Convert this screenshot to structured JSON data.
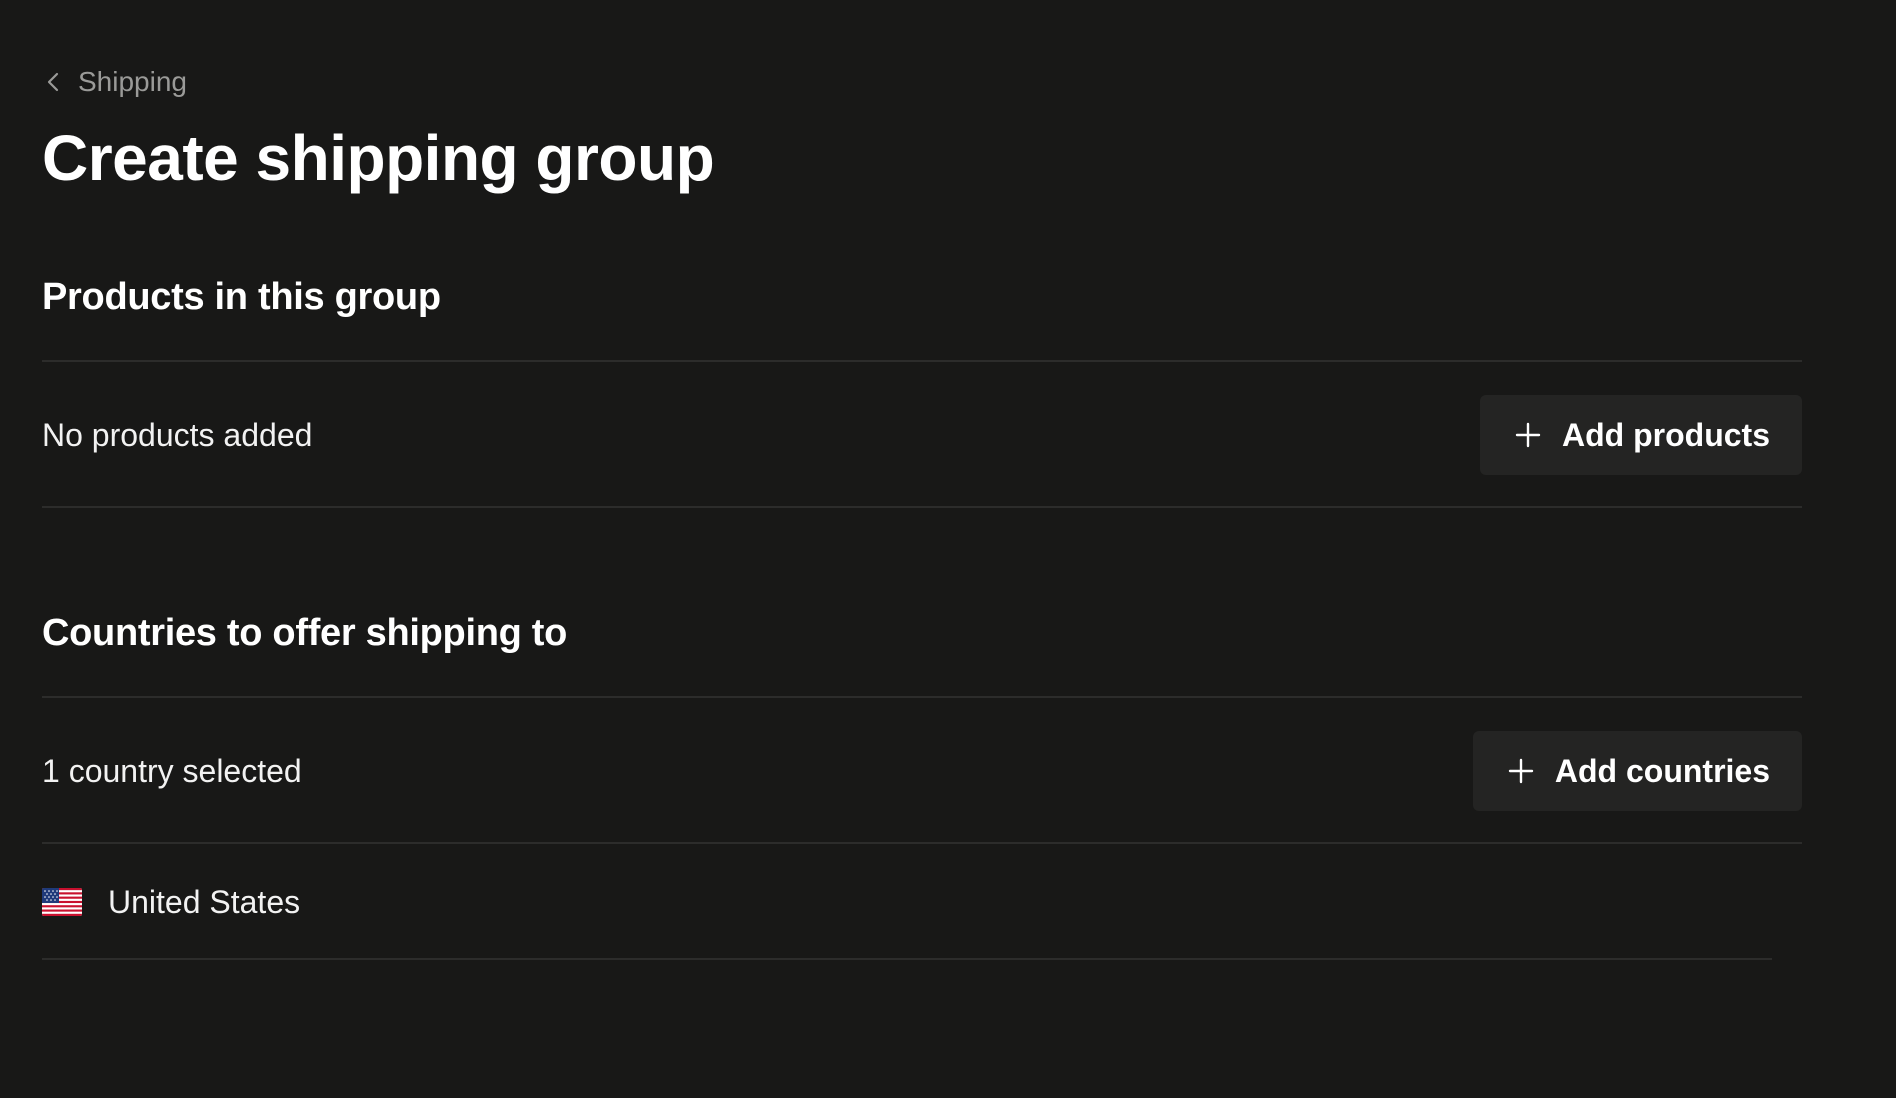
{
  "header": {
    "breadcrumb_label": "Shipping",
    "title": "Create shipping group"
  },
  "products_section": {
    "title": "Products in this group",
    "status_text": "No products added",
    "add_button_label": "Add products",
    "add_button_icon": "plus-icon"
  },
  "countries_section": {
    "title": "Countries to offer shipping to",
    "status_text": "1 country selected",
    "add_button_label": "Add countries",
    "add_button_icon": "plus-icon",
    "countries": [
      {
        "name": "United States",
        "flag_icon": "us-flag-icon"
      }
    ]
  },
  "colors": {
    "background": "#181817",
    "button_background": "#242423",
    "divider": "#2c2c2b",
    "muted_text": "#9a9a98",
    "text": "#ffffff"
  }
}
